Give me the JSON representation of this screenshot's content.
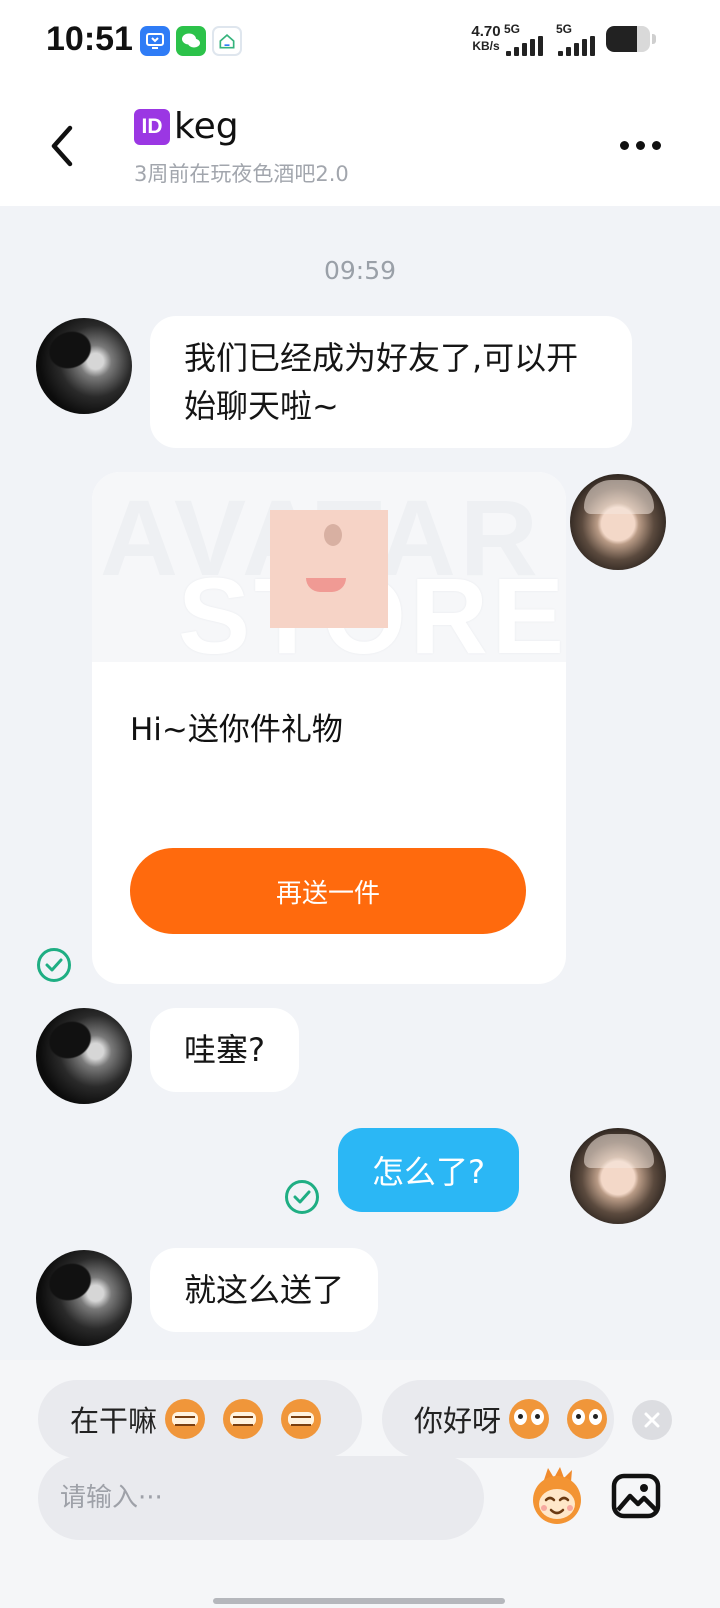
{
  "status_bar": {
    "time": "10:51",
    "net_speed_value": "4.70",
    "net_speed_unit": "KB/s",
    "signal_1_label": "5G",
    "signal_2_label": "5G",
    "app_icons": [
      "remote-desktop-icon",
      "wechat-icon",
      "smart-home-icon"
    ],
    "battery_level": 0.7
  },
  "header": {
    "id_badge": "ID",
    "contact_name": "keg",
    "contact_status": "3周前在玩夜色酒吧2.0"
  },
  "chat": {
    "timestamp": "09:59",
    "messages": [
      {
        "side": "in",
        "text": "我们已经成为好友了,可以开始聊天啦~"
      },
      {
        "side": "out",
        "type": "gift",
        "text": "Hi~送你件礼物",
        "button": "再送一件",
        "banner_text_1": "AVATAR",
        "banner_text_2": "STORE"
      },
      {
        "side": "in",
        "text": "哇塞?"
      },
      {
        "side": "out",
        "text": "怎么了?"
      },
      {
        "side": "in",
        "text": "就这么送了"
      }
    ]
  },
  "quick_replies": [
    {
      "text": "在干嘛",
      "emoji_count": 3
    },
    {
      "text": "你好呀",
      "emoji_count": 2
    }
  ],
  "input": {
    "placeholder": "请输入···"
  },
  "colors": {
    "accent_orange": "#ff6a0d",
    "outgoing_bubble": "#2bb7f5",
    "sent_check": "#1fae83",
    "id_badge": "#9b37e3"
  }
}
